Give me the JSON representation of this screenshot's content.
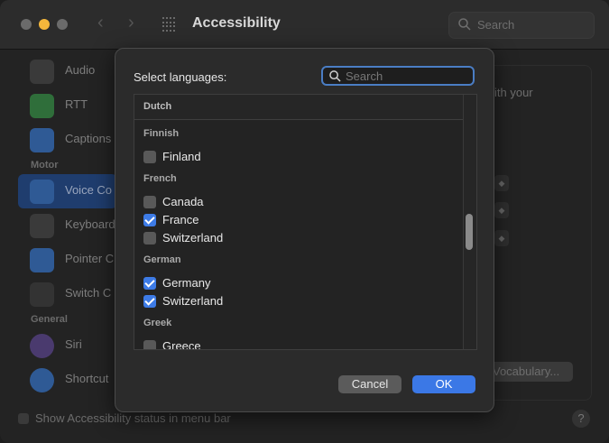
{
  "window": {
    "title": "Accessibility",
    "back_glyph": "‹",
    "forward_glyph": "›",
    "search_placeholder": "Search"
  },
  "sidebar": {
    "items": [
      {
        "label": "Audio",
        "icon": "audio-icon",
        "color": "#3a3a3a"
      },
      {
        "label": "RTT",
        "icon": "rtt-icon",
        "color": "#2f6e3a"
      },
      {
        "label": "Captions",
        "icon": "captions-icon",
        "color": "#2f5a95"
      },
      {
        "label": "Voice Co",
        "icon": "voice-control-icon",
        "color": "#2f5a95"
      },
      {
        "label": "Keyboard",
        "icon": "keyboard-icon",
        "color": "#3a3a3a"
      },
      {
        "label": "Pointer C",
        "icon": "pointer-icon",
        "color": "#2f5a95"
      },
      {
        "label": "Switch C",
        "icon": "switch-control-icon",
        "color": "#333333"
      },
      {
        "label": "Siri",
        "icon": "siri-icon",
        "color": "#4a3a6e"
      },
      {
        "label": "Shortcut",
        "icon": "shortcut-icon",
        "color": "#2f5a95"
      }
    ],
    "section_motor": "Motor",
    "section_general": "General"
  },
  "background": {
    "with_your_text": "ith your",
    "vocabulary_button": "Vocabulary...",
    "footer_label": "Show Accessibility status in menu bar",
    "help_label": "?"
  },
  "sheet": {
    "title": "Select languages:",
    "search_placeholder": "Search",
    "header_group": "Dutch",
    "groups": [
      {
        "name": "Finnish",
        "options": [
          {
            "label": "Finland",
            "checked": false
          }
        ]
      },
      {
        "name": "French",
        "options": [
          {
            "label": "Canada",
            "checked": false
          },
          {
            "label": "France",
            "checked": true
          },
          {
            "label": "Switzerland",
            "checked": false
          }
        ]
      },
      {
        "name": "German",
        "options": [
          {
            "label": "Germany",
            "checked": true
          },
          {
            "label": "Switzerland",
            "checked": true
          }
        ]
      },
      {
        "name": "Greek",
        "options": [
          {
            "label": "Greece",
            "checked": false
          }
        ]
      }
    ],
    "cancel_label": "Cancel",
    "ok_label": "OK"
  }
}
